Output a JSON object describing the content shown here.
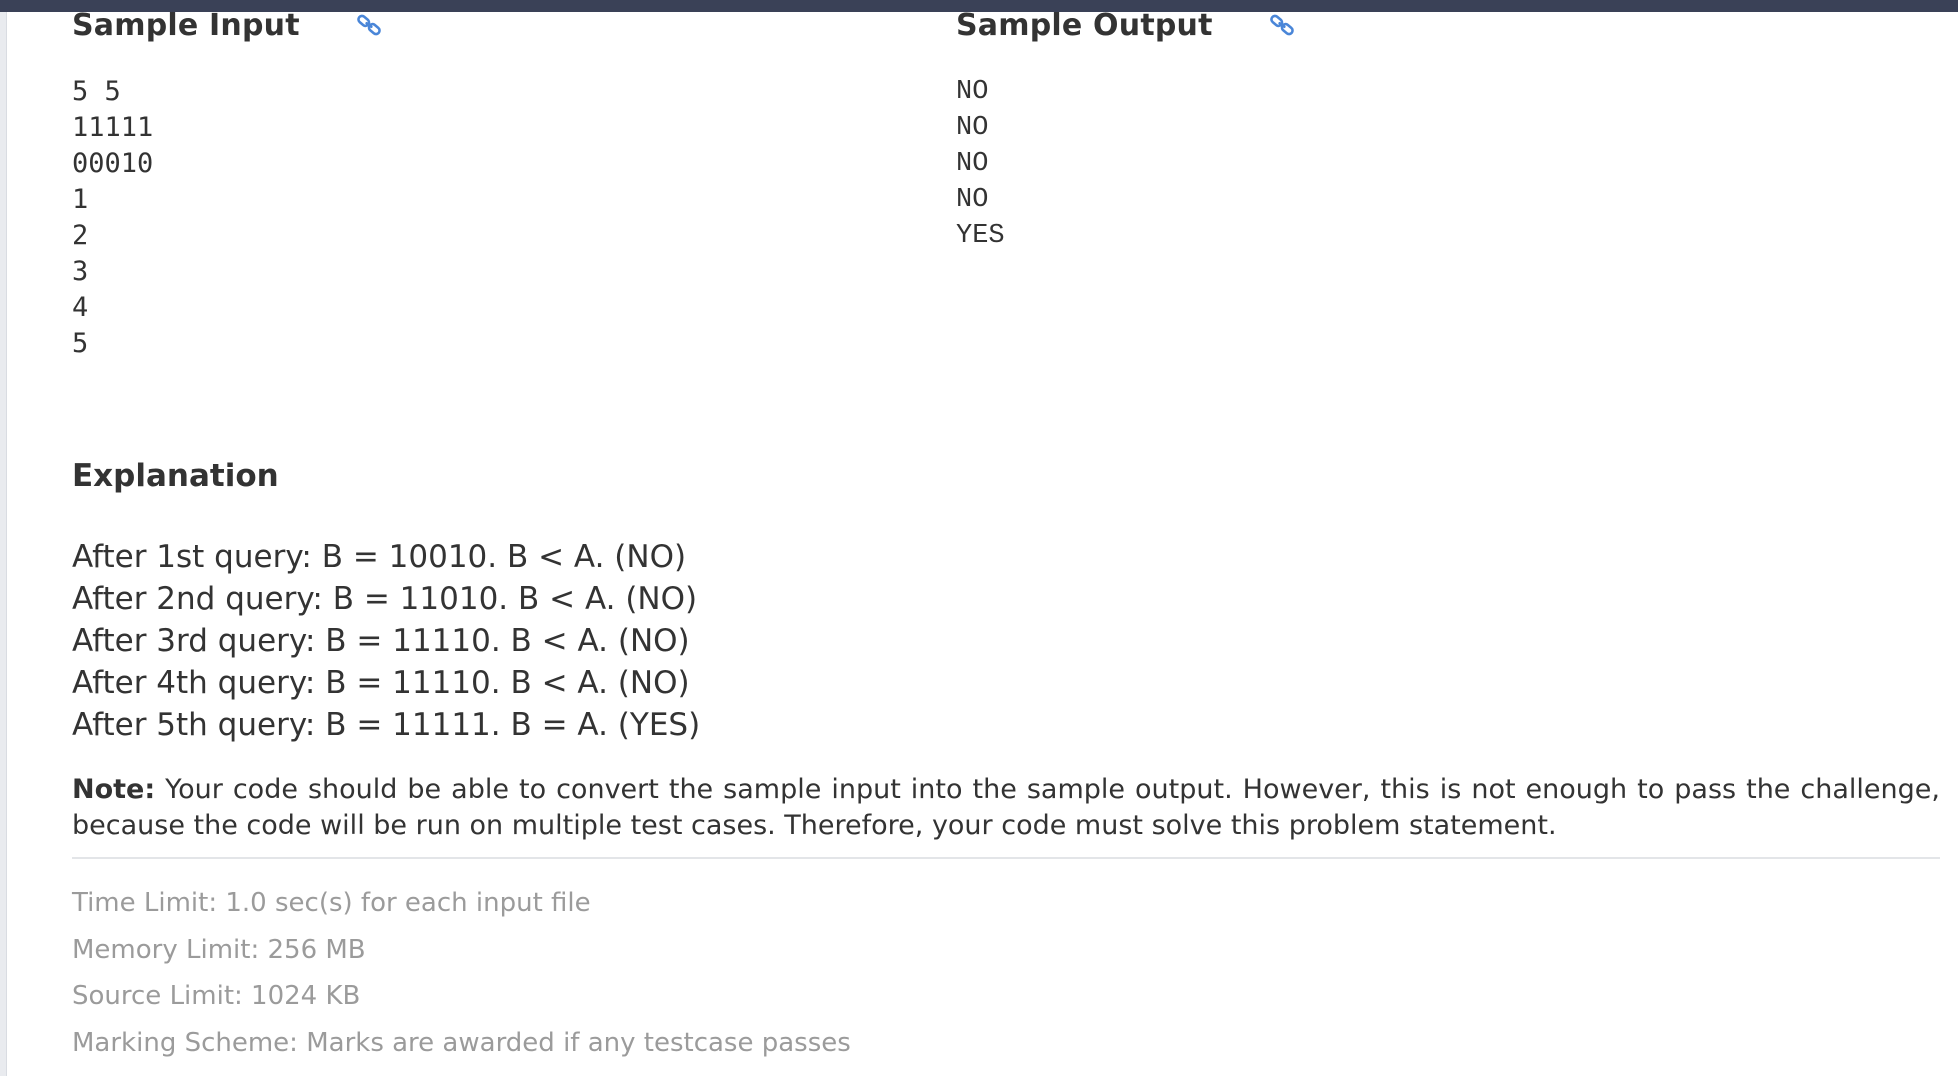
{
  "sample_input": {
    "title": "Sample Input",
    "lines": [
      "5 5",
      "11111",
      "00010",
      "1",
      "2",
      "3",
      "4",
      "5"
    ]
  },
  "sample_output": {
    "title": "Sample Output",
    "lines": [
      "NO",
      "NO",
      "NO",
      "NO",
      "YES"
    ]
  },
  "explanation": {
    "title": "Explanation",
    "lines": [
      "After 1st query: B = 10010. B < A. (NO)",
      "After 2nd query: B = 11010. B < A. (NO)",
      "After 3rd query: B = 11110. B < A. (NO)",
      "After 4th query: B = 11110. B < A. (NO)",
      "After 5th query: B = 11111. B = A. (YES)"
    ]
  },
  "note": {
    "label": "Note:",
    "text": " Your code should be able to convert the sample input into the sample output. However, this is not enough to pass the challenge, because the code will be run on multiple test cases. Therefore, your code must solve this problem statement."
  },
  "limits": {
    "time": "Time Limit: 1.0 sec(s) for each input file",
    "memory": "Memory Limit: 256 MB",
    "source": "Source Limit: 1024 KB",
    "marking": "Marking Scheme: Marks are awarded if any testcase passes"
  },
  "icons": {
    "copy_link_input": "link-icon",
    "copy_link_output": "link-icon"
  },
  "colors": {
    "accent": "#4a86d8",
    "top_bar": "#3a4157",
    "muted_text": "#9b9b9b"
  }
}
